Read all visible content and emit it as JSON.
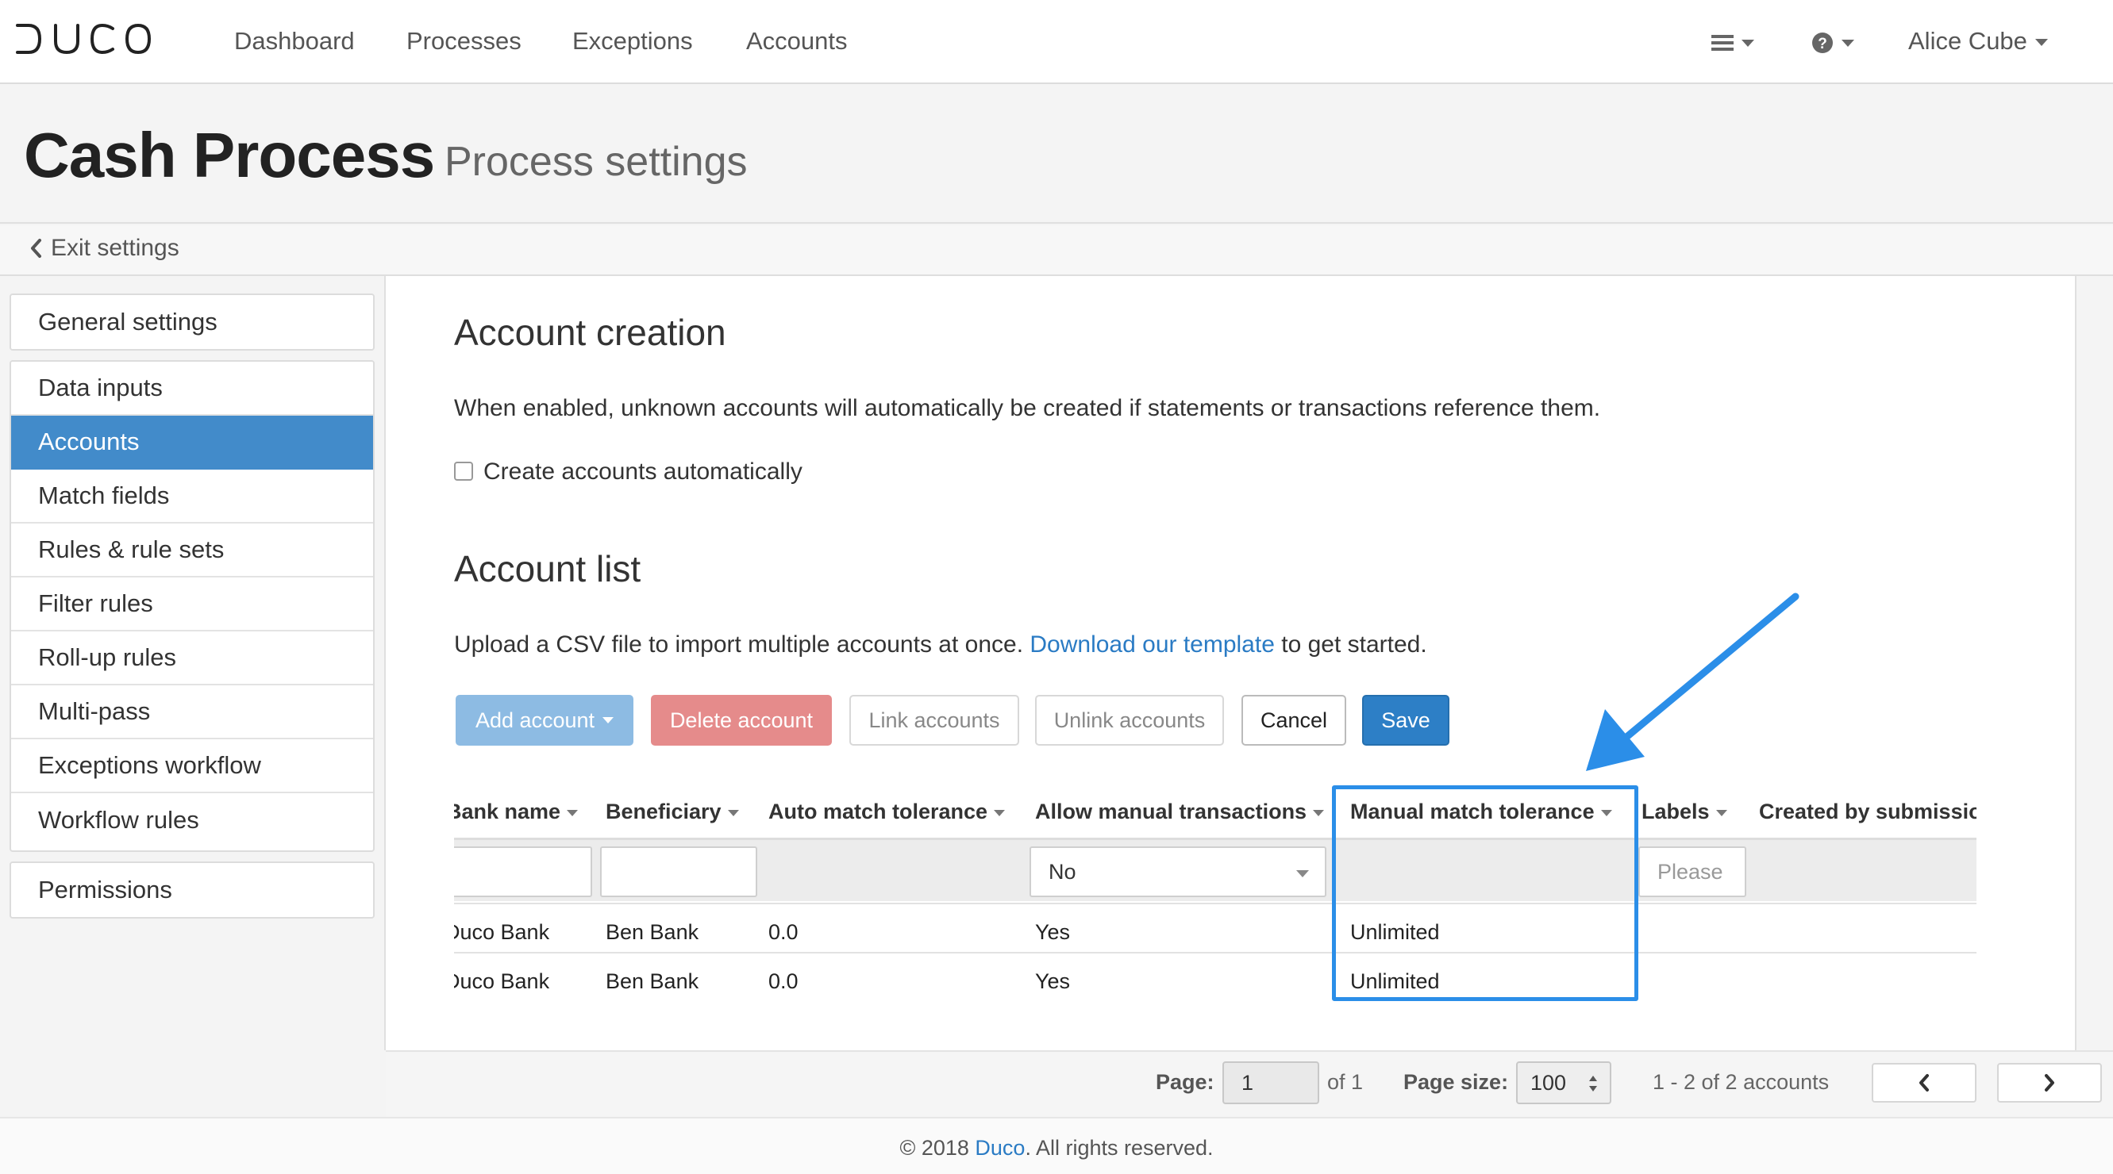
{
  "brand": {
    "logo_text": "DUCO"
  },
  "nav": {
    "links": [
      "Dashboard",
      "Processes",
      "Exceptions",
      "Accounts"
    ],
    "user_name": "Alice Cube"
  },
  "header": {
    "title": "Cash Process",
    "subtitle": "Process settings",
    "exit_label": "Exit settings"
  },
  "sidebar": {
    "groups": [
      [
        "General settings"
      ],
      [
        "Data inputs",
        "Accounts",
        "Match fields",
        "Rules & rule sets",
        "Filter rules",
        "Roll-up rules",
        "Multi-pass",
        "Exceptions workflow",
        "Workflow rules"
      ],
      [
        "Permissions"
      ]
    ],
    "active": "Accounts"
  },
  "account_creation": {
    "heading": "Account creation",
    "description": "When enabled, unknown accounts will automatically be created if statements or transactions reference them.",
    "checkbox_label": "Create accounts automatically",
    "checked": false
  },
  "account_list": {
    "heading": "Account list",
    "upload_text_before": "Upload a CSV file to import multiple accounts at once.",
    "template_link": "Download our template",
    "upload_text_after": "to get started."
  },
  "buttons": {
    "add": "Add account",
    "delete": "Delete account",
    "link": "Link accounts",
    "unlink": "Unlink accounts",
    "cancel": "Cancel",
    "save": "Save"
  },
  "table": {
    "columns": [
      "Bank name",
      "Beneficiary",
      "Auto match tolerance",
      "Allow manual transactions",
      "Manual match tolerance",
      "Labels",
      "Created by submission"
    ],
    "filters": {
      "allow_manual_value": "No",
      "labels_placeholder": "Please"
    },
    "rows": [
      [
        "Duco Bank",
        "Ben Bank",
        "0.0",
        "Yes",
        "Unlimited"
      ],
      [
        "Duco Bank",
        "Ben Bank",
        "0.0",
        "Yes",
        "Unlimited"
      ]
    ]
  },
  "pager": {
    "page_label": "Page:",
    "page_value": "1",
    "of_text": "of 1",
    "size_label": "Page size:",
    "size_value": "100",
    "summary": "1 - 2 of 2 accounts"
  },
  "footer": {
    "prefix": "© 2018",
    "link": "Duco",
    "suffix": ". All rights reserved."
  },
  "colors": {
    "accent": "#428bca",
    "highlight": "#2b8ee8",
    "danger": "#e58b8b",
    "link": "#2a7bc4"
  }
}
